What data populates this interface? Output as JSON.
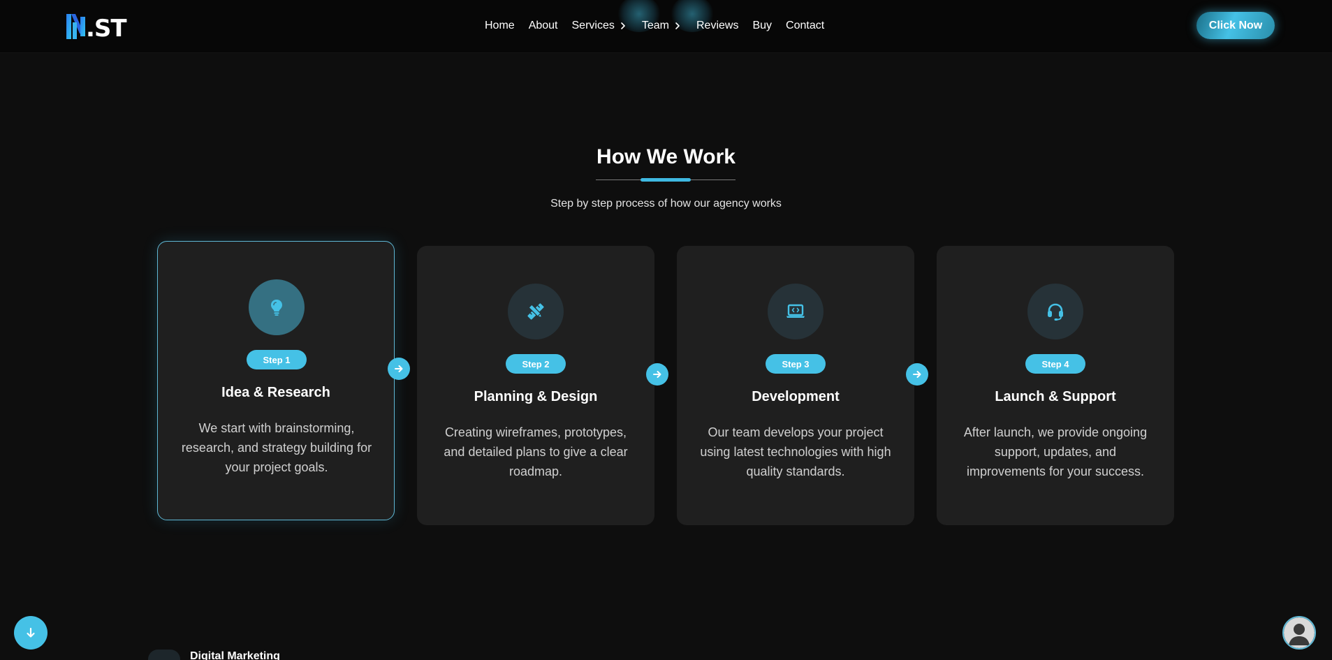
{
  "header": {
    "logo_text": ".ST",
    "nav": [
      {
        "label": "Home"
      },
      {
        "label": "About"
      },
      {
        "label": "Services",
        "has_submenu": true
      },
      {
        "label": "Team",
        "has_submenu": true
      },
      {
        "label": "Reviews"
      },
      {
        "label": "Buy"
      },
      {
        "label": "Contact"
      }
    ],
    "cta_label": "Click Now"
  },
  "section": {
    "title": "How We Work",
    "subtitle": "Step by step process of how our agency works"
  },
  "steps": [
    {
      "badge": "Step 1",
      "title": "Idea & Research",
      "description": "We start with brainstorming, research, and strategy building for your project goals.",
      "icon": "lightbulb-icon",
      "active": true
    },
    {
      "badge": "Step 2",
      "title": "Planning & Design",
      "description": "Creating wireframes, prototypes, and detailed plans to give a clear roadmap.",
      "icon": "pencil-ruler-icon",
      "active": false
    },
    {
      "badge": "Step 3",
      "title": "Development",
      "description": "Our team develops your project using latest technologies with high quality standards.",
      "icon": "laptop-code-icon",
      "active": false
    },
    {
      "badge": "Step 4",
      "title": "Launch & Support",
      "description": "After launch, we provide ongoing support, updates, and improvements for your success.",
      "icon": "headset-icon",
      "active": false
    }
  ],
  "next_section": {
    "label": "Digital Marketing"
  },
  "colors": {
    "accent": "#45c1e6",
    "background": "#0e0e0e",
    "card": "#1f1f1f",
    "header": "#070707"
  }
}
